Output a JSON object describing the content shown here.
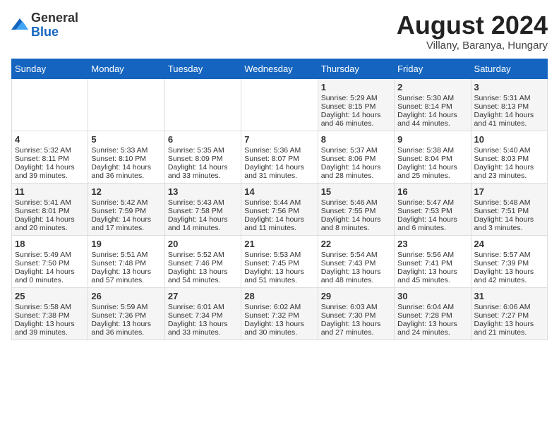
{
  "header": {
    "logo_general": "General",
    "logo_blue": "Blue",
    "title": "August 2024",
    "subtitle": "Villany, Baranya, Hungary"
  },
  "weekdays": [
    "Sunday",
    "Monday",
    "Tuesday",
    "Wednesday",
    "Thursday",
    "Friday",
    "Saturday"
  ],
  "weeks": [
    [
      {
        "day": "",
        "content": ""
      },
      {
        "day": "",
        "content": ""
      },
      {
        "day": "",
        "content": ""
      },
      {
        "day": "",
        "content": ""
      },
      {
        "day": "1",
        "content": "Sunrise: 5:29 AM\nSunset: 8:15 PM\nDaylight: 14 hours\nand 46 minutes."
      },
      {
        "day": "2",
        "content": "Sunrise: 5:30 AM\nSunset: 8:14 PM\nDaylight: 14 hours\nand 44 minutes."
      },
      {
        "day": "3",
        "content": "Sunrise: 5:31 AM\nSunset: 8:13 PM\nDaylight: 14 hours\nand 41 minutes."
      }
    ],
    [
      {
        "day": "4",
        "content": "Sunrise: 5:32 AM\nSunset: 8:11 PM\nDaylight: 14 hours\nand 39 minutes."
      },
      {
        "day": "5",
        "content": "Sunrise: 5:33 AM\nSunset: 8:10 PM\nDaylight: 14 hours\nand 36 minutes."
      },
      {
        "day": "6",
        "content": "Sunrise: 5:35 AM\nSunset: 8:09 PM\nDaylight: 14 hours\nand 33 minutes."
      },
      {
        "day": "7",
        "content": "Sunrise: 5:36 AM\nSunset: 8:07 PM\nDaylight: 14 hours\nand 31 minutes."
      },
      {
        "day": "8",
        "content": "Sunrise: 5:37 AM\nSunset: 8:06 PM\nDaylight: 14 hours\nand 28 minutes."
      },
      {
        "day": "9",
        "content": "Sunrise: 5:38 AM\nSunset: 8:04 PM\nDaylight: 14 hours\nand 25 minutes."
      },
      {
        "day": "10",
        "content": "Sunrise: 5:40 AM\nSunset: 8:03 PM\nDaylight: 14 hours\nand 23 minutes."
      }
    ],
    [
      {
        "day": "11",
        "content": "Sunrise: 5:41 AM\nSunset: 8:01 PM\nDaylight: 14 hours\nand 20 minutes."
      },
      {
        "day": "12",
        "content": "Sunrise: 5:42 AM\nSunset: 7:59 PM\nDaylight: 14 hours\nand 17 minutes."
      },
      {
        "day": "13",
        "content": "Sunrise: 5:43 AM\nSunset: 7:58 PM\nDaylight: 14 hours\nand 14 minutes."
      },
      {
        "day": "14",
        "content": "Sunrise: 5:44 AM\nSunset: 7:56 PM\nDaylight: 14 hours\nand 11 minutes."
      },
      {
        "day": "15",
        "content": "Sunrise: 5:46 AM\nSunset: 7:55 PM\nDaylight: 14 hours\nand 8 minutes."
      },
      {
        "day": "16",
        "content": "Sunrise: 5:47 AM\nSunset: 7:53 PM\nDaylight: 14 hours\nand 6 minutes."
      },
      {
        "day": "17",
        "content": "Sunrise: 5:48 AM\nSunset: 7:51 PM\nDaylight: 14 hours\nand 3 minutes."
      }
    ],
    [
      {
        "day": "18",
        "content": "Sunrise: 5:49 AM\nSunset: 7:50 PM\nDaylight: 14 hours\nand 0 minutes."
      },
      {
        "day": "19",
        "content": "Sunrise: 5:51 AM\nSunset: 7:48 PM\nDaylight: 13 hours\nand 57 minutes."
      },
      {
        "day": "20",
        "content": "Sunrise: 5:52 AM\nSunset: 7:46 PM\nDaylight: 13 hours\nand 54 minutes."
      },
      {
        "day": "21",
        "content": "Sunrise: 5:53 AM\nSunset: 7:45 PM\nDaylight: 13 hours\nand 51 minutes."
      },
      {
        "day": "22",
        "content": "Sunrise: 5:54 AM\nSunset: 7:43 PM\nDaylight: 13 hours\nand 48 minutes."
      },
      {
        "day": "23",
        "content": "Sunrise: 5:56 AM\nSunset: 7:41 PM\nDaylight: 13 hours\nand 45 minutes."
      },
      {
        "day": "24",
        "content": "Sunrise: 5:57 AM\nSunset: 7:39 PM\nDaylight: 13 hours\nand 42 minutes."
      }
    ],
    [
      {
        "day": "25",
        "content": "Sunrise: 5:58 AM\nSunset: 7:38 PM\nDaylight: 13 hours\nand 39 minutes."
      },
      {
        "day": "26",
        "content": "Sunrise: 5:59 AM\nSunset: 7:36 PM\nDaylight: 13 hours\nand 36 minutes."
      },
      {
        "day": "27",
        "content": "Sunrise: 6:01 AM\nSunset: 7:34 PM\nDaylight: 13 hours\nand 33 minutes."
      },
      {
        "day": "28",
        "content": "Sunrise: 6:02 AM\nSunset: 7:32 PM\nDaylight: 13 hours\nand 30 minutes."
      },
      {
        "day": "29",
        "content": "Sunrise: 6:03 AM\nSunset: 7:30 PM\nDaylight: 13 hours\nand 27 minutes."
      },
      {
        "day": "30",
        "content": "Sunrise: 6:04 AM\nSunset: 7:28 PM\nDaylight: 13 hours\nand 24 minutes."
      },
      {
        "day": "31",
        "content": "Sunrise: 6:06 AM\nSunset: 7:27 PM\nDaylight: 13 hours\nand 21 minutes."
      }
    ]
  ]
}
